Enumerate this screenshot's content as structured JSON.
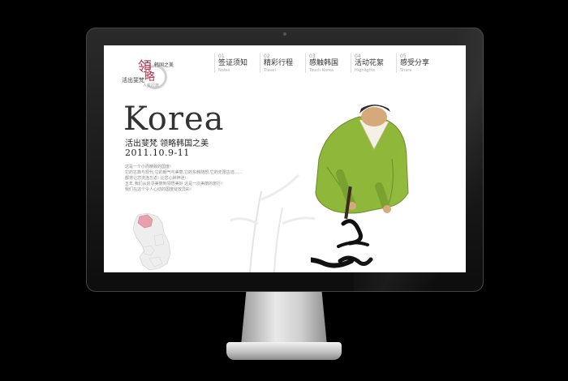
{
  "logo": {
    "big1": "領",
    "big2": "略",
    "line1": "韩国之美",
    "line2": "活出斐梵",
    "line3": "人文行旅"
  },
  "nav": [
    {
      "num": "01",
      "label": "签证须知",
      "en": "Notes"
    },
    {
      "num": "02",
      "label": "精彩行程",
      "en": "Travel"
    },
    {
      "num": "03",
      "label": "感触韩国",
      "en": "Touch Korea"
    },
    {
      "num": "04",
      "label": "活动花絮",
      "en": "Highlights"
    },
    {
      "num": "05",
      "label": "感受分享",
      "en": "Share"
    }
  ],
  "hero": {
    "title": "Korea",
    "subtitle": "活出斐梵  领略韩国之美",
    "date": "2011.10.9-11"
  },
  "intro_lines": [
    "这是一个小而精致的国度!",
    "它的古典与现代,它的朝气与美丽,它的东韩随想,它的无限古迹……",
    "都将让您流连忘返! 让您心醉神迷!",
    "五年,我们从追寻美丽到领悟美好 这是一次美丽的旅行!",
    "我们在这个令人心动的国度绽放异彩!"
  ],
  "colors": {
    "accent": "#b22f49",
    "robe": "#8fb83a",
    "map_highlight": "#e8a0aa"
  }
}
